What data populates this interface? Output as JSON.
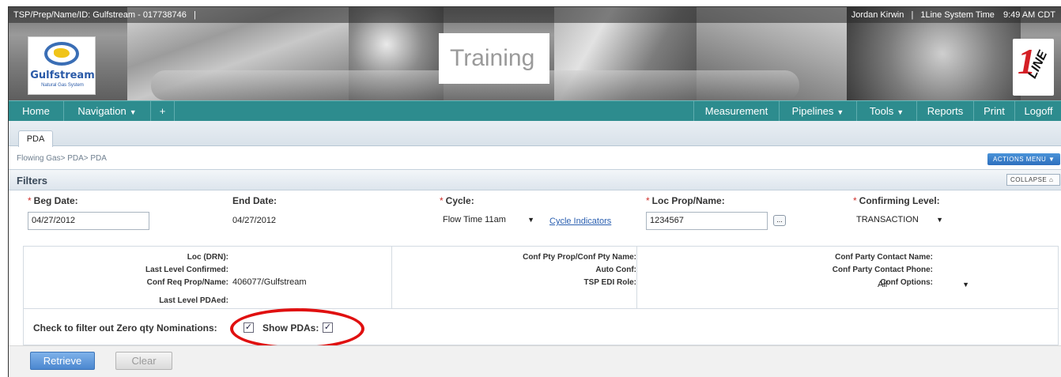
{
  "header": {
    "tsp_label": "TSP/Prep/Name/ID: Gulfstream - 017738746",
    "tsp_sep": "|",
    "user": "Jordan Kirwin",
    "user_sep": "|",
    "system_time_label": "1Line System Time",
    "system_time": "9:49 AM CDT",
    "training": "Training",
    "logo_name": "Gulfstream",
    "logo_sub": "Natural Gas System",
    "brand_one": "1",
    "brand_line": "LINE"
  },
  "nav": {
    "home": "Home",
    "navigation": "Navigation",
    "plus": "+",
    "measurement": "Measurement",
    "pipelines": "Pipelines",
    "tools": "Tools",
    "reports": "Reports",
    "print": "Print",
    "logoff": "Logoff",
    "caret": "▼"
  },
  "tab": {
    "label": "PDA"
  },
  "breadcrumb": "Flowing Gas> PDA> PDA",
  "actions_menu": "ACTIONS MENU ▼",
  "filters": {
    "title": "Filters",
    "collapse": "COLLAPSE ⌂",
    "required_mark": "*",
    "beg_date_label": "Beg Date:",
    "beg_date_value": "04/27/2012",
    "end_date_label": "End Date:",
    "end_date_value": "04/27/2012",
    "cycle_label": "Cycle:",
    "cycle_value": "Flow Time 11am",
    "cycle_indicators": "Cycle Indicators",
    "loc_label": "Loc Prop/Name:",
    "loc_value": "1234567",
    "loc_lookup": "...",
    "confirming_label": "Confirming Level:",
    "confirming_value": "TRANSACTION"
  },
  "info": {
    "loc_drn": "Loc (DRN):",
    "last_level_confirmed": "Last Level Confirmed:",
    "conf_req_label": "Conf Req Prop/Name:",
    "conf_req_value": "406077/Gulfstream",
    "last_level_pdaed": "Last Level PDAed:",
    "conf_pty_prop": "Conf Pty Prop/Conf Pty Name:",
    "auto_conf": "Auto Conf:",
    "tsp_edi_role": "TSP EDI Role:",
    "conf_party_contact_name": "Conf Party Contact Name:",
    "conf_party_contact_phone": "Conf Party Contact Phone:",
    "conf_options_label": "Conf Options:",
    "conf_options_value": "All"
  },
  "checks": {
    "zero_qty_label": "Check to filter out Zero qty Nominations:",
    "zero_qty_checked": true,
    "show_pdas_label": "Show PDAs:",
    "show_pdas_checked": true,
    "check_glyph": "✓"
  },
  "buttons": {
    "retrieve": "Retrieve",
    "clear": "Clear"
  },
  "colors": {
    "nav_teal": "#2d8c8e",
    "required_red": "#d0312d",
    "highlight_circle": "#e01010",
    "link_blue": "#2a5fb0"
  }
}
